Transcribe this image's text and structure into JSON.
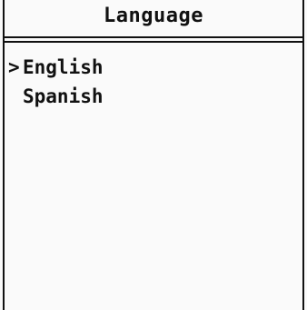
{
  "screen": {
    "title": "Language"
  },
  "menu": {
    "cursor_glyph": ">",
    "items": [
      {
        "label": "English",
        "selected": true
      },
      {
        "label": "Spanish",
        "selected": false
      }
    ]
  }
}
